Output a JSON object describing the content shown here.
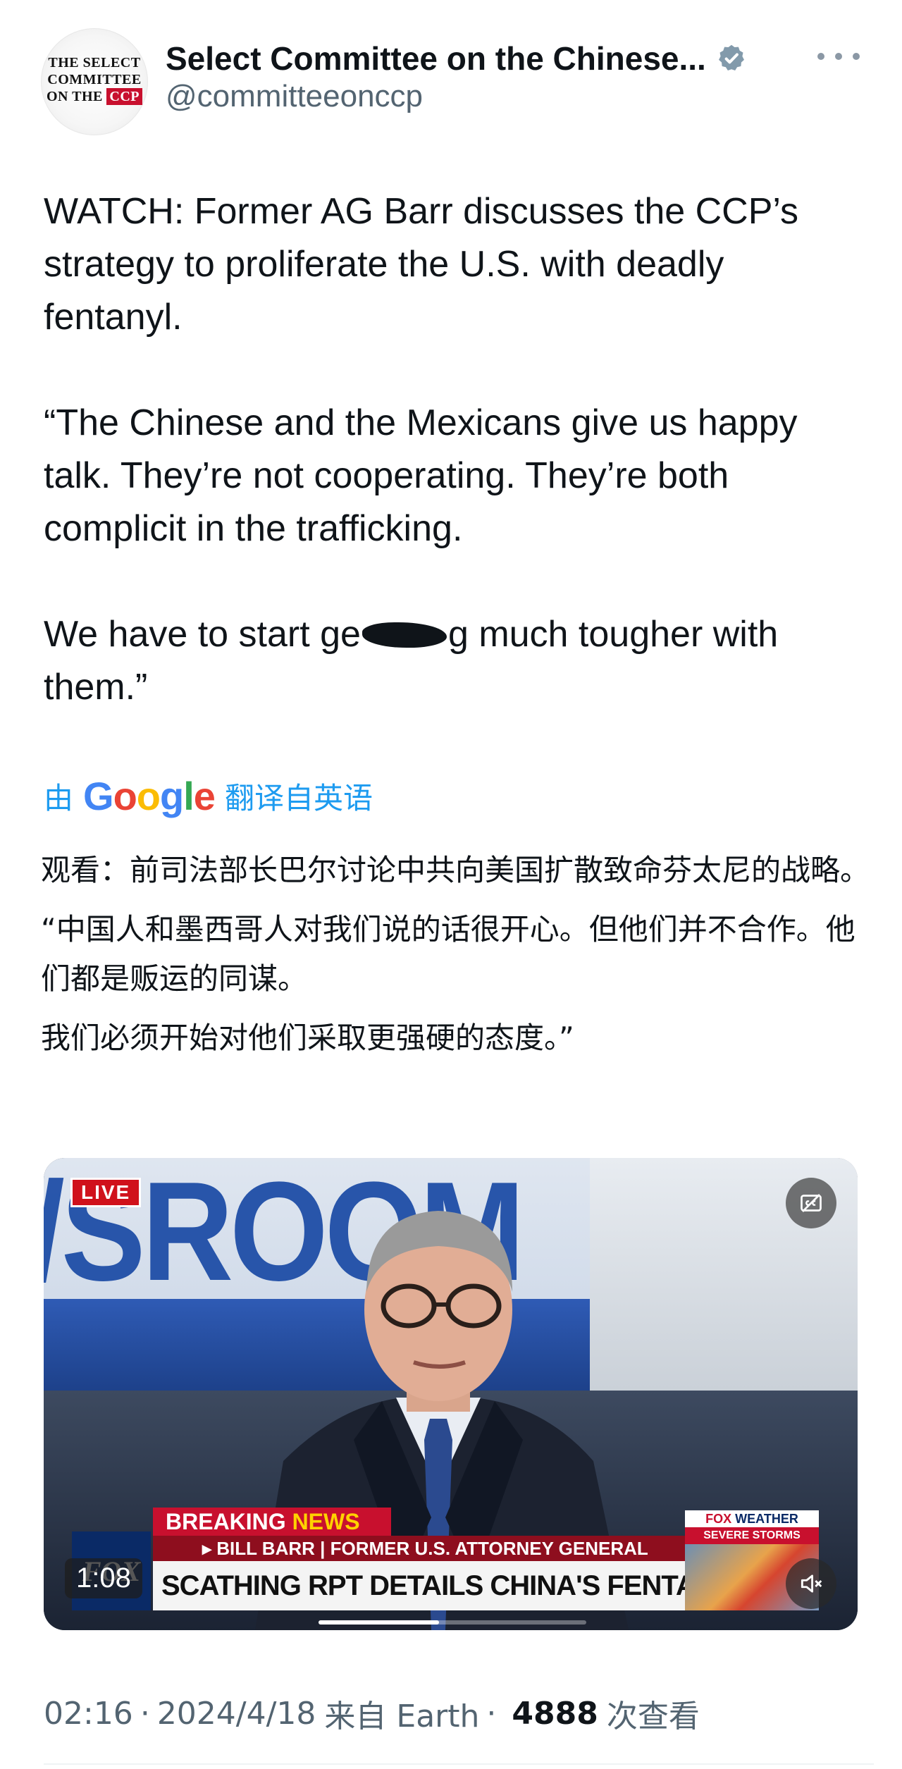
{
  "author": {
    "display_name": "Select Committee on the Chinese...",
    "handle": "@committeeonccp",
    "avatar_lines": [
      "THE SELECT",
      "COMMITTEE",
      "ON THE",
      "CCP"
    ],
    "verified": true
  },
  "tweet": {
    "paragraphs": [
      "WATCH: Former AG Barr discusses the CCP’s strategy to proliferate the U.S. with deadly fentanyl.",
      "“The Chinese and the Mexicans give us happy talk. They’re not cooperating. They’re both complicit in the trafficking."
    ],
    "last_line_before": "We have to start ge",
    "last_line_after": "g much tougher with them.”"
  },
  "translation": {
    "by_label": "由",
    "google_label": "Google",
    "from_label": "翻译自英语",
    "paragraphs": [
      "观看：前司法部长巴尔讨论中共向美国扩散致命芬太尼的战略。",
      "“中国人和墨西哥人对我们说的话很开心。但他们并不合作。他们都是贩运的同谋。",
      "我们必须开始对他们采取更强硬的态度。”"
    ]
  },
  "video": {
    "live_label": "LIVE",
    "studio_text": "/SROOM",
    "breaking_label": "BREAKING",
    "news_label": "NEWS",
    "name_bar": "▸ BILL BARR | FORMER U.S. ATTORNEY GENERAL",
    "headline": "SCATHING RPT DETAILS CHINA'S FENTANYL PRODUCTION",
    "fox_logo": "FOX",
    "weather_title_fox": "FOX",
    "weather_title_rest": " WEATHER",
    "weather_sub": "SEVERE STORMS",
    "time": "1:08",
    "progress_fraction": 0.45
  },
  "meta": {
    "time": "02:16",
    "date": "2024/4/18",
    "source": "来自 Earth",
    "views": "4888",
    "views_label": "次查看",
    "separator": "·"
  },
  "colors": {
    "text_primary": "#0f1419",
    "text_secondary": "#536471",
    "link_blue": "#1d9bf0",
    "fox_red": "#c8102e"
  },
  "icons": [
    "verified-badge-icon",
    "more-dots-icon",
    "captions-icon",
    "mute-icon"
  ]
}
